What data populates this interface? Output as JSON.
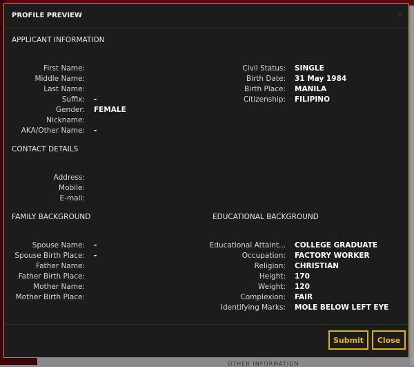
{
  "modal": {
    "title": "PROFILE PREVIEW",
    "close_icon": "×"
  },
  "sections": {
    "applicant": "APPLICANT INFORMATION",
    "contact": "CONTACT DETAILS",
    "family": "FAMILY BACKGROUND",
    "educational": "EDUCATIONAL BACKGROUND"
  },
  "applicant_left": [
    {
      "label": "First Name:",
      "value": ""
    },
    {
      "label": "Middle Name:",
      "value": ""
    },
    {
      "label": "Last Name:",
      "value": ""
    },
    {
      "label": "Suffix:",
      "value": "-"
    },
    {
      "label": "Gender:",
      "value": "FEMALE"
    },
    {
      "label": "Nickname:",
      "value": ""
    },
    {
      "label": "AKA/Other Name:",
      "value": "-"
    }
  ],
  "applicant_right": [
    {
      "label": "Civil Status:",
      "value": "SINGLE"
    },
    {
      "label": "Birth Date:",
      "value": "31 May 1984"
    },
    {
      "label": "Birth Place:",
      "value": "MANILA"
    },
    {
      "label": "Citizenship:",
      "value": "FILIPINO"
    }
  ],
  "contact": [
    {
      "label": "Address:",
      "value": ""
    },
    {
      "label": "Mobile:",
      "value": ""
    },
    {
      "label": "E-mail:",
      "value": ""
    }
  ],
  "family": [
    {
      "label": "Spouse Name:",
      "value": "-"
    },
    {
      "label": "Spouse Birth Place:",
      "value": "-"
    },
    {
      "label": "Father Name:",
      "value": ""
    },
    {
      "label": "Father Birth Place:",
      "value": ""
    },
    {
      "label": "Mother Name:",
      "value": ""
    },
    {
      "label": "Mother Birth Place:",
      "value": ""
    }
  ],
  "educational": [
    {
      "label": "Educational Attaint...",
      "value": "COLLEGE GRADUATE"
    },
    {
      "label": "Occupation:",
      "value": "FACTORY WORKER"
    },
    {
      "label": "Religion:",
      "value": "CHRISTIAN"
    },
    {
      "label": "Height:",
      "value": "170"
    },
    {
      "label": "Weight:",
      "value": "120"
    },
    {
      "label": "Complexion:",
      "value": "FAIR"
    },
    {
      "label": "Identifying Marks:",
      "value": "MOLE BELOW LEFT EYE"
    }
  ],
  "footer": {
    "submit_label": "Submit",
    "close_label": "Close"
  },
  "background": {
    "partial_text": "OTHER INFORMATION"
  }
}
